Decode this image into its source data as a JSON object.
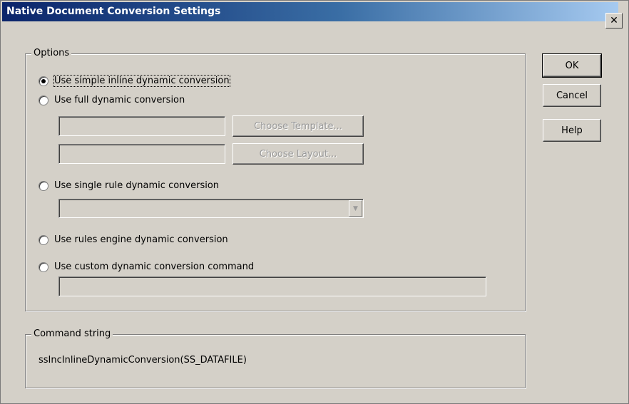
{
  "window": {
    "title": "Native Document Conversion Settings",
    "close_glyph": "✕"
  },
  "options_group": {
    "legend": "Options",
    "radio_simple": "Use simple inline dynamic conversion",
    "radio_full": "Use full dynamic conversion",
    "choose_template": "Choose Template...",
    "choose_layout": "Choose Layout...",
    "radio_single_rule": "Use single rule dynamic conversion",
    "radio_rules_engine": "Use rules engine dynamic conversion",
    "radio_custom": "Use custom dynamic conversion command",
    "selected": "simple",
    "dropdown_arrow": "▼"
  },
  "command_group": {
    "legend": "Command string",
    "value": "ssIncInlineDynamicConversion(SS_DATAFILE)"
  },
  "buttons": {
    "ok": "OK",
    "cancel": "Cancel",
    "help": "Help"
  }
}
